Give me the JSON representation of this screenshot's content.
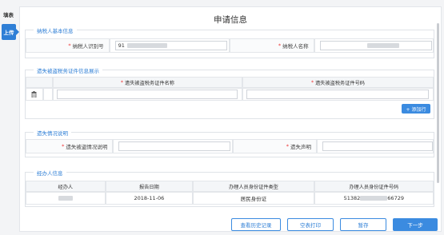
{
  "sidebar": {
    "label": "填表",
    "tab": "上传"
  },
  "page": {
    "title": "申请信息"
  },
  "section_basic": {
    "legend": "纳税人基本信息",
    "taxpayer_id_label": "纳税人识别号",
    "taxpayer_id_value": "91",
    "taxpayer_name_label": "纳税人名称"
  },
  "section_certs": {
    "legend": "遗失被盗税务证件信息展示",
    "col_name": "遗失被盗税务证件名称",
    "col_number": "遗失被盗税务证件号码",
    "add_button": "+ 添加行"
  },
  "section_explain": {
    "legend": "遗失情况说明",
    "explain_label": "遗失被盗情况说明",
    "statement_label": "遗失声明"
  },
  "section_agent": {
    "legend": "经办人信息",
    "headers": [
      "经办人",
      "报告日期",
      "办理人员身份证件类型",
      "办理人员身份证件号码"
    ],
    "report_date": "2018-11-06",
    "id_type": "居民身份证",
    "id_prefix": "51382",
    "id_suffix": "66729"
  },
  "actions": {
    "history": "查看历史记录",
    "print": "空表打印",
    "save": "暂存",
    "next": "下一步"
  }
}
